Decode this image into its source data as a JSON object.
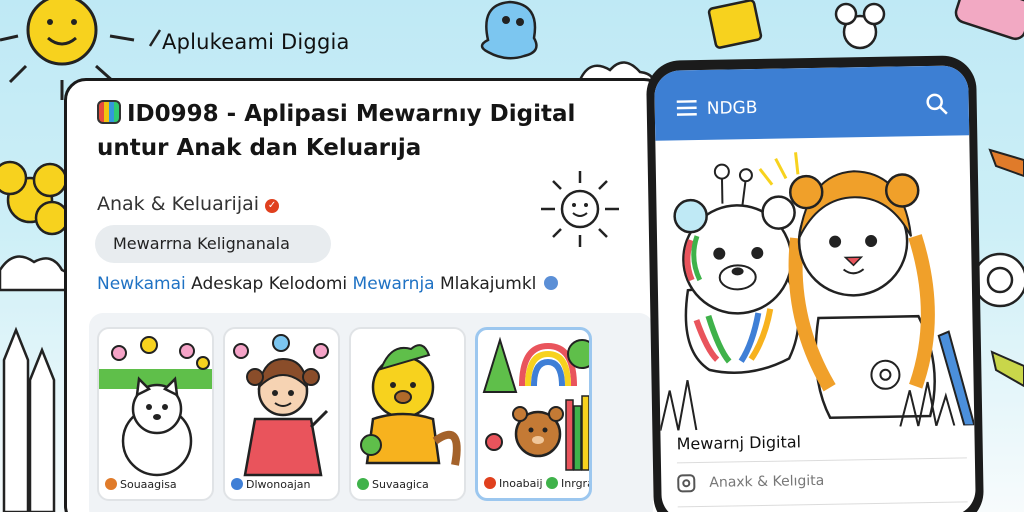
{
  "banner": {
    "text": "Aplukeami Diggia"
  },
  "app": {
    "title_line1": "ID0998 - Aplipasi Mewarnıy Digital",
    "title_line2": "untur Anak dan Keluarıja",
    "developer": "Anak & Keluarijai",
    "category_chip": "Mewarrna Kelignanala",
    "tagline_part1": "Newkamai",
    "tagline_part2": "Adeskap Kelodomi",
    "tagline_part3": "Mewarnja",
    "tagline_part4": "Mlakajumkl"
  },
  "screenshots": [
    {
      "label": "Souaagisa",
      "dot_color": "#e07b2a"
    },
    {
      "label": "Dlwonoajan",
      "dot_color": "#3f7fd6"
    },
    {
      "label": "Suvaagica",
      "dot_color": "#3fb24a"
    },
    {
      "label_a": "Inoabaij",
      "label_b": "Inrgrat",
      "dot_color_a": "#e0401e",
      "dot_color_b": "#3fb24a"
    }
  ],
  "phone": {
    "header_title": "NDGB",
    "caption": "Mewarnj Digital",
    "sub_label": "Anaxk & Kelıgita"
  },
  "colors": {
    "accent_blue": "#3d7fd3",
    "link_blue": "#1f72c4",
    "sky": "#bfe9f5"
  }
}
